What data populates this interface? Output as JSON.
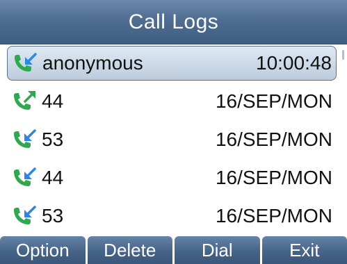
{
  "header": {
    "title": "Call Logs"
  },
  "call_logs": [
    {
      "number": "anonymous",
      "time": "10:00:48",
      "type": "received",
      "selected": true
    },
    {
      "number": "44",
      "time": "16/SEP/MON",
      "type": "dialed",
      "selected": false
    },
    {
      "number": "53",
      "time": "16/SEP/MON",
      "type": "received",
      "selected": false
    },
    {
      "number": "44",
      "time": "16/SEP/MON",
      "type": "received",
      "selected": false
    },
    {
      "number": "53",
      "time": "16/SEP/MON",
      "type": "received",
      "selected": false
    }
  ],
  "softkeys": {
    "option": "Option",
    "delete": "Delete",
    "dial": "Dial",
    "exit": "Exit"
  },
  "colors": {
    "header": "#4f6d91",
    "handset": "#2fa84f",
    "arrow": "#2d87e0",
    "selected_row": "#c9d6e4"
  }
}
